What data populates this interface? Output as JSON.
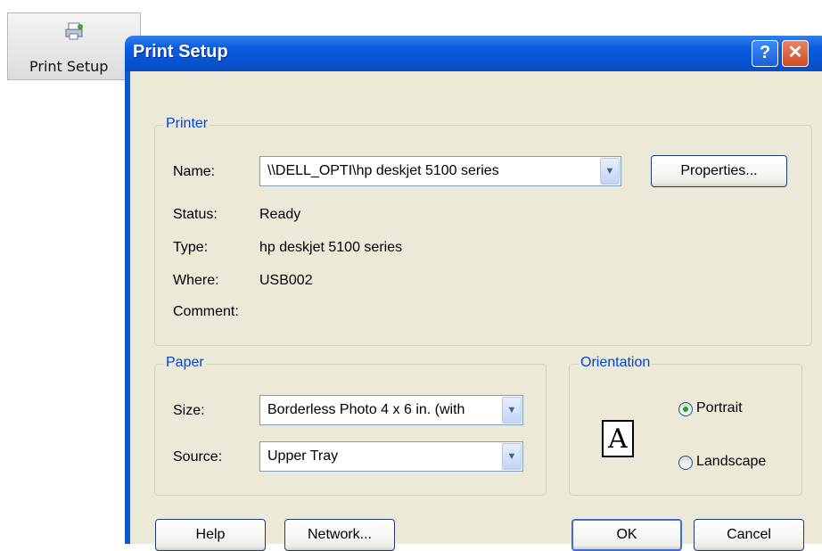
{
  "toolbar": {
    "print_setup_label": "Print Setup",
    "icon": "print-setup-icon"
  },
  "dialog": {
    "title": "Print Setup",
    "help_glyph": "?",
    "close_glyph": "✕",
    "printer": {
      "group_label": "Printer",
      "name_label": "Name:",
      "name_value": "\\\\DELL_OPTI\\hp deskjet 5100 series",
      "properties_button": "Properties...",
      "status_label": "Status:",
      "status_value": "Ready",
      "type_label": "Type:",
      "type_value": "hp deskjet 5100 series",
      "where_label": "Where:",
      "where_value": "USB002",
      "comment_label": "Comment:",
      "comment_value": ""
    },
    "paper": {
      "group_label": "Paper",
      "size_label": "Size:",
      "size_value": "Borderless Photo 4 x 6 in. (with",
      "source_label": "Source:",
      "source_value": "Upper Tray"
    },
    "orientation": {
      "group_label": "Orientation",
      "page_glyph": "A",
      "portrait_label": "Portrait",
      "landscape_label": "Landscape",
      "selected": "Portrait"
    },
    "buttons": {
      "help": "Help",
      "network": "Network...",
      "ok": "OK",
      "cancel": "Cancel"
    }
  },
  "colors": {
    "title_bar": "#0653d2",
    "group_title": "#0046d5",
    "dialog_bg": "#ece9d8"
  }
}
